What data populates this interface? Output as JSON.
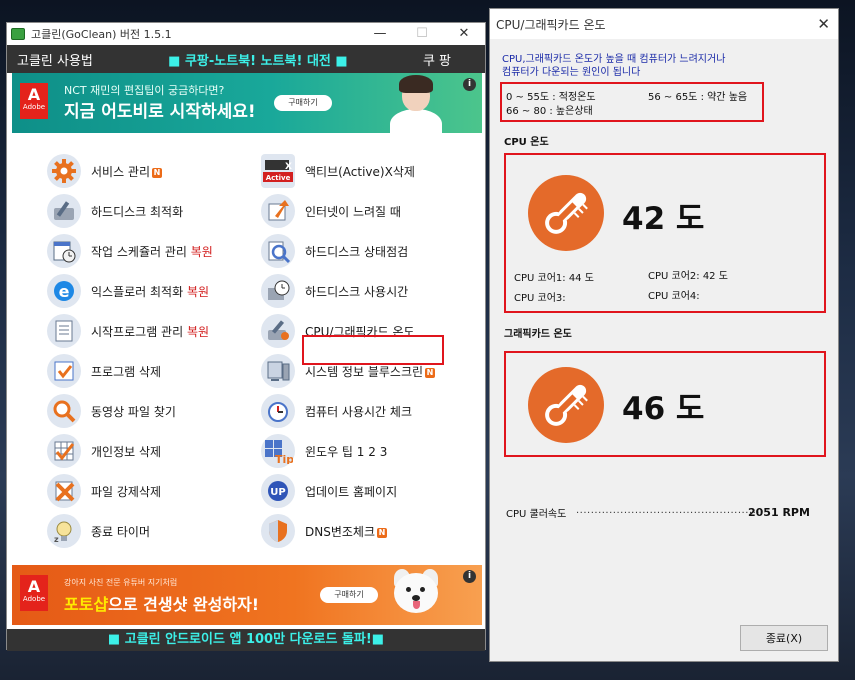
{
  "main_window": {
    "title": "고클린(GoClean) 버전 1.5.1",
    "controls": {
      "minimize": "—",
      "maximize": "☐",
      "close": "✕"
    },
    "menubar": {
      "left": "고클린 사용법",
      "center": "■ 쿠팡-노트북! 노트북! 대전 ■",
      "right": "쿠 팡"
    },
    "ad_top": {
      "brand": "Adobe",
      "small": "NCT 재민의 편집팁이 궁금하다면?",
      "big": "지금 어도비로 시작하세요!",
      "button": "구매하기",
      "info": "i"
    },
    "ad_bottom": {
      "brand": "Adobe",
      "small": "강아지 사진 전문 유튜버 지기처럼",
      "big_highlight": "포토샵",
      "big_rest": "으로 견생샷 완성하자!",
      "button": "구매하기",
      "info": "i"
    },
    "left_items": [
      {
        "label": "서비스 관리",
        "badge": "N",
        "red": ""
      },
      {
        "label": "하드디스크 최적화",
        "badge": "",
        "red": ""
      },
      {
        "label": "작업 스케쥴러 관리 ",
        "badge": "",
        "red": "복원"
      },
      {
        "label": "익스플로러 최적화 ",
        "badge": "",
        "red": "복원"
      },
      {
        "label": "시작프로그램 관리 ",
        "badge": "",
        "red": "복원"
      },
      {
        "label": "프로그램 삭제",
        "badge": "",
        "red": ""
      },
      {
        "label": "동영상 파일 찾기",
        "badge": "",
        "red": ""
      },
      {
        "label": "개인정보 삭제",
        "badge": "",
        "red": ""
      },
      {
        "label": "파일 강제삭제",
        "badge": "",
        "red": ""
      },
      {
        "label": "종료 타이머",
        "badge": "",
        "red": ""
      }
    ],
    "right_items": [
      {
        "label": "액티브(Active)X삭제",
        "badge": "",
        "red": ""
      },
      {
        "label": "인터넷이 느려질 때",
        "badge": "",
        "red": ""
      },
      {
        "label": "하드디스크 상태점검",
        "badge": "",
        "red": ""
      },
      {
        "label": "하드디스크 사용시간",
        "badge": "",
        "red": ""
      },
      {
        "label": "CPU/그래픽카드 온도",
        "badge": "",
        "red": ""
      },
      {
        "label": "시스템 정보  블루스크린",
        "badge": "N",
        "red": ""
      },
      {
        "label": "컴퓨터 사용시간 체크",
        "badge": "",
        "red": ""
      },
      {
        "label": "윈도우 팁 1    2    3",
        "badge": "",
        "red": ""
      },
      {
        "label": "업데이트      홈페이지",
        "badge": "",
        "red": ""
      },
      {
        "label": "DNS변조체크",
        "badge": "N",
        "red": ""
      }
    ],
    "bottom_bar": "■ 고클린 안드로이드 앱 100만 다운로드 돌파!■"
  },
  "temp_window": {
    "title": "CPU/그래픽카드 온도",
    "close": "✕",
    "info_line1": "CPU,그래픽카드 온도가 높을 때 컴퓨터가 느려지거나",
    "info_line2": "컴퓨터가 다운되는 원인이 됩니다",
    "range1": "0  ~ 55도 : 적정온도",
    "range2": "56 ~ 65도 : 약간 높음",
    "range3": "66 ~ 80 : 높은상태",
    "cpu_section": "CPU 온도",
    "cpu_temp": "42 도",
    "cores": {
      "c1": "CPU 코어1: 44 도",
      "c2": "CPU 코어2: 42 도",
      "c3": "CPU 코어3:",
      "c4": "CPU 코어4:"
    },
    "gpu_section": "그래픽카드 온도",
    "gpu_temp": "46 도",
    "fan_label": "CPU 쿨러속도",
    "fan_dots": "...................................................",
    "fan_value": "2051 RPM",
    "close_button": "종료(X)"
  },
  "colors": {
    "accent_cyan": "#3cf0e8",
    "highlight_red": "#e0151d",
    "thermo_orange": "#e46a2a",
    "info_blue": "#1a2aa8"
  }
}
